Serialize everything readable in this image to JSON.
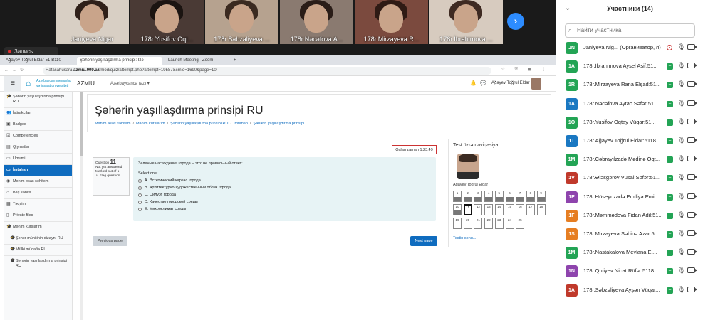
{
  "zoom": {
    "videos": [
      {
        "name": "Janiyeva Nigar",
        "bg": "#d8cfc4",
        "hair": "#2f2019"
      },
      {
        "name": "178r.Yusifov Oqt...",
        "bg": "#4a3a35",
        "hair": "#1b1411"
      },
      {
        "name": "178r.Sabzaliyeva ...",
        "bg": "#b6a28f",
        "hair": "#3b2a20"
      },
      {
        "name": "178r.Nəcəfova A...",
        "bg": "#8a7a70",
        "hair": "#2a1d18"
      },
      {
        "name": "178r.Mirzayeva R...",
        "bg": "#7b4a3e",
        "hair": "#2e1a14"
      },
      {
        "name": "178r.İbrahimova ...",
        "bg": "#d7cbbf",
        "hair": "#3e2a22"
      }
    ],
    "next_icon": "chevron-right-icon",
    "recording_label": "Запись..."
  },
  "browser": {
    "tabs": [
      "Ağayev Toğrul Eldar-51-B110",
      "Şəhərin yaşıllaşdırma prinsipi: Izə",
      "Launch Meeting - Zoom"
    ],
    "url_prefix": "Hafasahusara ",
    "url_host": "azmiu.009.az",
    "url_path": "/mod/quiz/attempt.php?attempt=19587&cmid=1690&page=10"
  },
  "moodle": {
    "logo_line1": "Azərbaycan memarlıq",
    "logo_line2": "və inşaat universiteti",
    "site_name": "AZMIU",
    "language": "Azərbaycanca (az) ▾",
    "user_name": "Ağayev Toğrul Eldar",
    "sidebar": [
      {
        "label": "Şəhərin yaşıllaşdırma prinsipi RU",
        "icon": "cap-icon",
        "glyph": "🎓",
        "sub": false,
        "active": false
      },
      {
        "label": "İştirakçılar",
        "icon": "users-icon",
        "glyph": "👥",
        "sub": false,
        "active": false
      },
      {
        "label": "Badges",
        "icon": "badge-icon",
        "glyph": "▣",
        "sub": false,
        "active": false
      },
      {
        "label": "Competencies",
        "icon": "check-icon",
        "glyph": "☑",
        "sub": false,
        "active": false
      },
      {
        "label": "Qiymətlər",
        "icon": "grades-icon",
        "glyph": "▤",
        "sub": false,
        "active": false
      },
      {
        "label": "Ümumi",
        "icon": "folder-icon",
        "glyph": "▭",
        "sub": false,
        "active": false
      },
      {
        "label": "İmtahan",
        "icon": "folder-icon",
        "glyph": "▭",
        "sub": false,
        "active": true
      },
      {
        "label": "Mənim əsas səhifəm",
        "icon": "dashboard-icon",
        "glyph": "◉",
        "sub": false,
        "active": false
      },
      {
        "label": "Baş səhifə",
        "icon": "home-icon",
        "glyph": "⌂",
        "sub": false,
        "active": false
      },
      {
        "label": "Təqvim",
        "icon": "calendar-icon",
        "glyph": "▦",
        "sub": false,
        "active": false
      },
      {
        "label": "Private files",
        "icon": "file-icon",
        "glyph": "▯",
        "sub": false,
        "active": false
      },
      {
        "label": "Mənim kurslarım",
        "icon": "cap-icon",
        "glyph": "🎓",
        "sub": false,
        "active": false
      },
      {
        "label": "Şəhər mühitinin dizaynı RU",
        "icon": "cap-icon",
        "glyph": "🎓",
        "sub": true,
        "active": false
      },
      {
        "label": "Mülki müdafiə RU",
        "icon": "cap-icon",
        "glyph": "🎓",
        "sub": true,
        "active": false
      },
      {
        "label": "Şəhərin yaşıllaşdırma prinsipi RU",
        "icon": "cap-icon",
        "glyph": "🎓",
        "sub": true,
        "active": false
      }
    ],
    "page_title": "Şəhərin yaşıllaşdırma prinsipi RU",
    "breadcrumbs": [
      "Mənim əsas səhifəm",
      "Mənim kurslarım",
      "Şəhərin yaşıllaşdırma prinsipi RU",
      "İmtahan",
      "Şəhərin yaşıllaşdırma prinsipi"
    ],
    "timer": "Qalan zaman 1:23:49",
    "question": {
      "label": "Question",
      "number": "11",
      "status": "Not yet answered",
      "marked": "Marked out of 1",
      "flag": "Flag question",
      "text": "Зеленые насаждения города – это: не правильный ответ:",
      "select_one": "Select one:",
      "options": [
        "A. Эстетический каркас города",
        "B. Архитектурно-художественный облик города",
        "C. Силуэт города",
        "D. Качество городской среды",
        "E. Микроклимат среды"
      ]
    },
    "prev_label": "Previous page",
    "next_label": "Next page",
    "nav": {
      "title": "Test üzrə naviqasiya",
      "user_name": "Ağayev Toğrul Eldar",
      "finish": "Testin sonu...",
      "cells": [
        {
          "n": "1",
          "answered": true,
          "current": false
        },
        {
          "n": "2",
          "answered": true,
          "current": false
        },
        {
          "n": "3",
          "answered": true,
          "current": false
        },
        {
          "n": "4",
          "answered": true,
          "current": false
        },
        {
          "n": "5",
          "answered": true,
          "current": false
        },
        {
          "n": "6",
          "answered": true,
          "current": false
        },
        {
          "n": "7",
          "answered": true,
          "current": false
        },
        {
          "n": "8",
          "answered": true,
          "current": false
        },
        {
          "n": "9",
          "answered": true,
          "current": false
        },
        {
          "n": "10",
          "answered": true,
          "current": false
        },
        {
          "n": "11",
          "answered": false,
          "current": true
        },
        {
          "n": "12",
          "answered": false,
          "current": false
        },
        {
          "n": "13",
          "answered": false,
          "current": false
        },
        {
          "n": "14",
          "answered": false,
          "current": false
        },
        {
          "n": "15",
          "answered": false,
          "current": false
        },
        {
          "n": "16",
          "answered": false,
          "current": false
        },
        {
          "n": "17",
          "answered": false,
          "current": false
        },
        {
          "n": "18",
          "answered": false,
          "current": false
        },
        {
          "n": "19",
          "answered": false,
          "current": false
        },
        {
          "n": "20",
          "answered": false,
          "current": false
        },
        {
          "n": "21",
          "answered": false,
          "current": false
        },
        {
          "n": "22",
          "answered": false,
          "current": false
        },
        {
          "n": "23",
          "answered": false,
          "current": false
        },
        {
          "n": "24",
          "answered": false,
          "current": false
        },
        {
          "n": "25",
          "answered": false,
          "current": false
        }
      ]
    }
  },
  "participants": {
    "title": "Участники (14)",
    "search_placeholder": "Найти участника",
    "list": [
      {
        "initials": "JN",
        "name": "Janiyeva Nig... (Организатор, я)",
        "color": "#23a455",
        "host": true
      },
      {
        "initials": "1A",
        "name": "178r.İbrahimova Aysel Asif:51...",
        "color": "#23a455",
        "host": false
      },
      {
        "initials": "1R",
        "name": "178r.Mirzayeva Rana Elşad:51...",
        "color": "#23a455",
        "host": false
      },
      {
        "initials": "1A",
        "name": "178r.Nəcəfova Aytac Səfər:51...",
        "color": "#1a78c2",
        "host": false
      },
      {
        "initials": "1O",
        "name": "178r.Yusifov Oqtay Vüqar:51...",
        "color": "#23a455",
        "host": false
      },
      {
        "initials": "1T",
        "name": "178r.Ağayev Toğrul Eldar:5118...",
        "color": "#1a78c2",
        "host": false
      },
      {
        "initials": "1M",
        "name": "178r.Cəbrayılzadə Mədinə Oqt...",
        "color": "#23a455",
        "host": false
      },
      {
        "initials": "1V",
        "name": "178r.Ələsgərov Vüsal Səfər:51...",
        "color": "#c0392b",
        "host": false
      },
      {
        "initials": "1E",
        "name": "178r.Hüseynzadə Emiliya Emil...",
        "color": "#8e44ad",
        "host": false
      },
      {
        "initials": "1F",
        "name": "178r.Məmmədova Fidan Adil:51...",
        "color": "#e67e22",
        "host": false
      },
      {
        "initials": "1S",
        "name": "178r.Mirzayeva Səbinə Azar:5...",
        "color": "#e67e22",
        "host": false
      },
      {
        "initials": "1M",
        "name": "178r.Nastakalova Mevlana El...",
        "color": "#23a455",
        "host": false
      },
      {
        "initials": "1N",
        "name": "178r.Quliyev Nicat Rüfət:5118...",
        "color": "#8e44ad",
        "host": false
      },
      {
        "initials": "1A",
        "name": "178r.Səbzəliyeva Ayşən Vüqar...",
        "color": "#c0392b",
        "host": false
      }
    ]
  }
}
